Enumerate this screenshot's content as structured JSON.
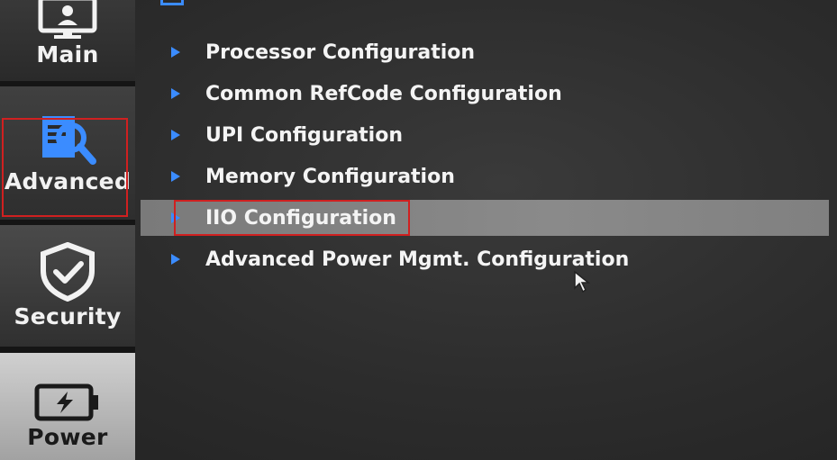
{
  "sidebar": {
    "items": [
      {
        "label": "Main",
        "icon": "monitor-icon"
      },
      {
        "label": "Advanced",
        "icon": "magnifier-document-icon"
      },
      {
        "label": "Security",
        "icon": "shield-check-icon"
      },
      {
        "label": "Power",
        "icon": "battery-icon"
      }
    ]
  },
  "menu": {
    "items": [
      {
        "label": "Processor Configuration"
      },
      {
        "label": "Common RefCode Configuration"
      },
      {
        "label": "UPI Configuration"
      },
      {
        "label": "Memory Configuration"
      },
      {
        "label": "IIO Configuration"
      },
      {
        "label": "Advanced Power Mgmt. Configuration"
      }
    ]
  },
  "colors": {
    "accent": "#3b8cff",
    "highlight_box": "#d02020",
    "selected_row": "#808080"
  }
}
